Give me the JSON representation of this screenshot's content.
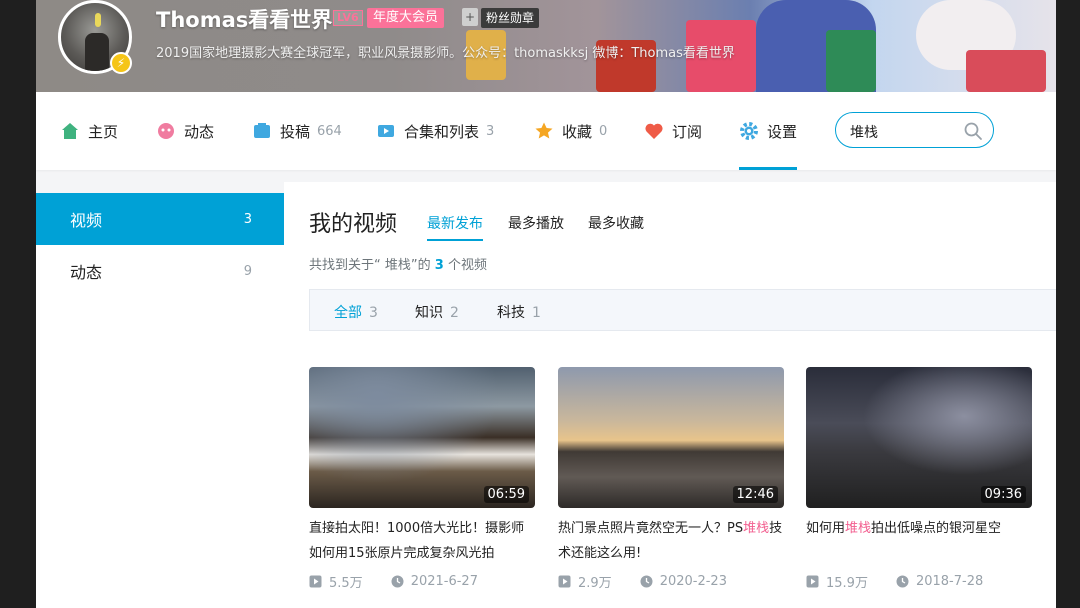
{
  "profile": {
    "name": "Thomas看看世界",
    "level": "LV6",
    "vip": "年度大会员",
    "fan_icon": "+",
    "fan_badge": "粉丝勋章",
    "bio": "2019国家地理摄影大赛全球冠军，职业风景摄影师。公众号：thomaskksj 微博：Thomas看看世界"
  },
  "nav": [
    {
      "label": "主页",
      "count": "",
      "icon": "home-icon",
      "color": "#3fb27f"
    },
    {
      "label": "动态",
      "count": "",
      "icon": "dynamic-icon",
      "color": "#f07ca0"
    },
    {
      "label": "投稿",
      "count": "664",
      "icon": "upload-icon",
      "color": "#3fa8e0"
    },
    {
      "label": "合集和列表",
      "count": "3",
      "icon": "collection-icon",
      "color": "#3fa8e0"
    },
    {
      "label": "收藏",
      "count": "0",
      "icon": "star-icon",
      "color": "#f5a623"
    },
    {
      "label": "订阅",
      "count": "",
      "icon": "heart-icon",
      "color": "#ef5b47"
    },
    {
      "label": "设置",
      "count": "",
      "icon": "gear-icon",
      "color": "#3fa8e0"
    }
  ],
  "search": {
    "value": "堆栈"
  },
  "sidebar": [
    {
      "label": "视频",
      "count": "3"
    },
    {
      "label": "动态",
      "count": "9"
    }
  ],
  "main": {
    "title": "我的视频",
    "sorts": [
      "最新发布",
      "最多播放",
      "最多收藏"
    ],
    "result_prefix": "共找到关于“ 堆栈”的",
    "result_count": "3",
    "result_suffix": "个视频",
    "filters": [
      {
        "label": "全部",
        "count": "3"
      },
      {
        "label": "知识",
        "count": "2"
      },
      {
        "label": "科技",
        "count": "1"
      }
    ]
  },
  "videos": [
    {
      "duration": "06:59",
      "title_a": "直接拍太阳！1000倍大光比！摄影师如何用15张原片完成复杂风光拍",
      "title_hl": "",
      "title_b": "",
      "views": "5.5万",
      "date": "2021-6-27"
    },
    {
      "duration": "12:46",
      "title_a": "热门景点照片竟然空无一人？PS",
      "title_hl": "堆栈",
      "title_b": "技术还能这么用!",
      "views": "2.9万",
      "date": "2020-2-23"
    },
    {
      "duration": "09:36",
      "title_a": "如何用",
      "title_hl": "堆栈",
      "title_b": "拍出低噪点的银河星空",
      "views": "15.9万",
      "date": "2018-7-28"
    }
  ],
  "colors": {
    "accent": "#00a1d6",
    "pink": "#fb7299",
    "highlight": "#f25d8e"
  }
}
